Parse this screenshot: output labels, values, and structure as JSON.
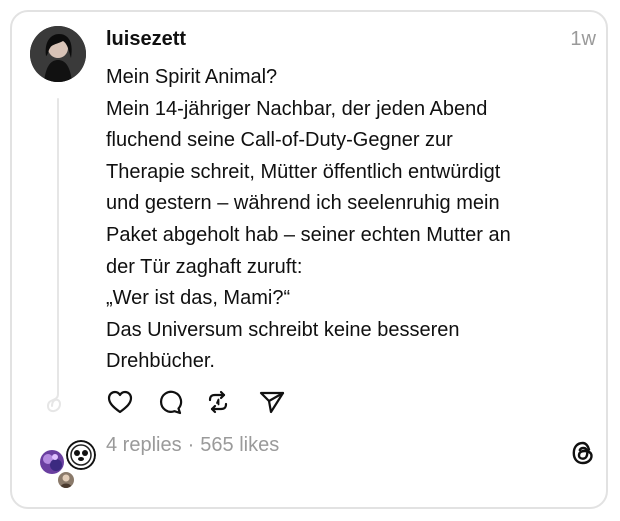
{
  "post": {
    "username": "luisezett",
    "timestamp": "1w",
    "lines": [
      "Mein Spirit Animal?",
      "Mein 14-jähriger Nachbar, der jeden Abend",
      "fluchend seine Call-of-Duty-Gegner zur",
      "Therapie schreit, Mütter öffentlich entwürdigt",
      "und gestern – während ich seelenruhig mein",
      "Paket abgeholt hab – seiner echten Mutter an",
      "der Tür zaghaft zuruft:",
      "„Wer ist das, Mami?“",
      "Das Universum schreibt keine besseren",
      "Drehbücher."
    ]
  },
  "actions": [
    {
      "name": "like-button",
      "icon": "heart-icon"
    },
    {
      "name": "reply-button",
      "icon": "comment-icon"
    },
    {
      "name": "repost-button",
      "icon": "repost-icon"
    },
    {
      "name": "share-button",
      "icon": "send-icon"
    }
  ],
  "stats": {
    "replies": "4 replies",
    "separator": "·",
    "likes": "565 likes"
  },
  "icons": {
    "logo": "threads-logo-icon"
  },
  "colors": {
    "text": "#101010",
    "muted": "#9a9a9a",
    "border": "#e2e2e2"
  }
}
